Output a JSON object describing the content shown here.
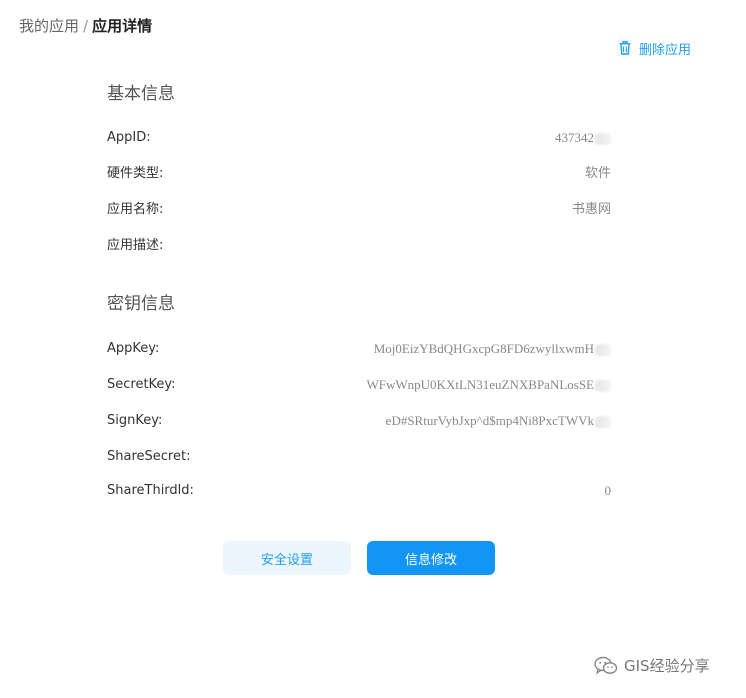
{
  "breadcrumb": {
    "parent": "我的应用",
    "separator": "/",
    "current": "应用详情"
  },
  "actions": {
    "delete_label": "删除应用",
    "delete_icon": "trash-icon"
  },
  "basic_info": {
    "title": "基本信息",
    "rows": [
      {
        "label": "AppID:",
        "value": "437342"
      },
      {
        "label": "硬件类型:",
        "value": "软件"
      },
      {
        "label": "应用名称:",
        "value": "书惠网"
      },
      {
        "label": "应用描述:",
        "value": ""
      }
    ]
  },
  "key_info": {
    "title": "密钥信息",
    "rows": [
      {
        "label": "AppKey:",
        "value": "Moj0EizYBdQHGxcpG8FD6zwyllxwmH"
      },
      {
        "label": "SecretKey:",
        "value": "WFwWnpU0KXtLN31euZNXBPaNLosSE"
      },
      {
        "label": "SignKey:",
        "value": "eD#SRturVybJxp^d$mp4Ni8PxcTWVk"
      },
      {
        "label": "ShareSecret:",
        "value": ""
      },
      {
        "label": "ShareThirdld:",
        "value": "0"
      }
    ]
  },
  "buttons": {
    "security_label": "安全设置",
    "edit_label": "信息修改"
  },
  "watermark": {
    "text": "GIS经验分享",
    "icon": "wechat-icon"
  },
  "colors": {
    "accent": "#1e9ff2",
    "primary_button": "#1296f5",
    "secondary_button_bg": "#eef6fd"
  }
}
